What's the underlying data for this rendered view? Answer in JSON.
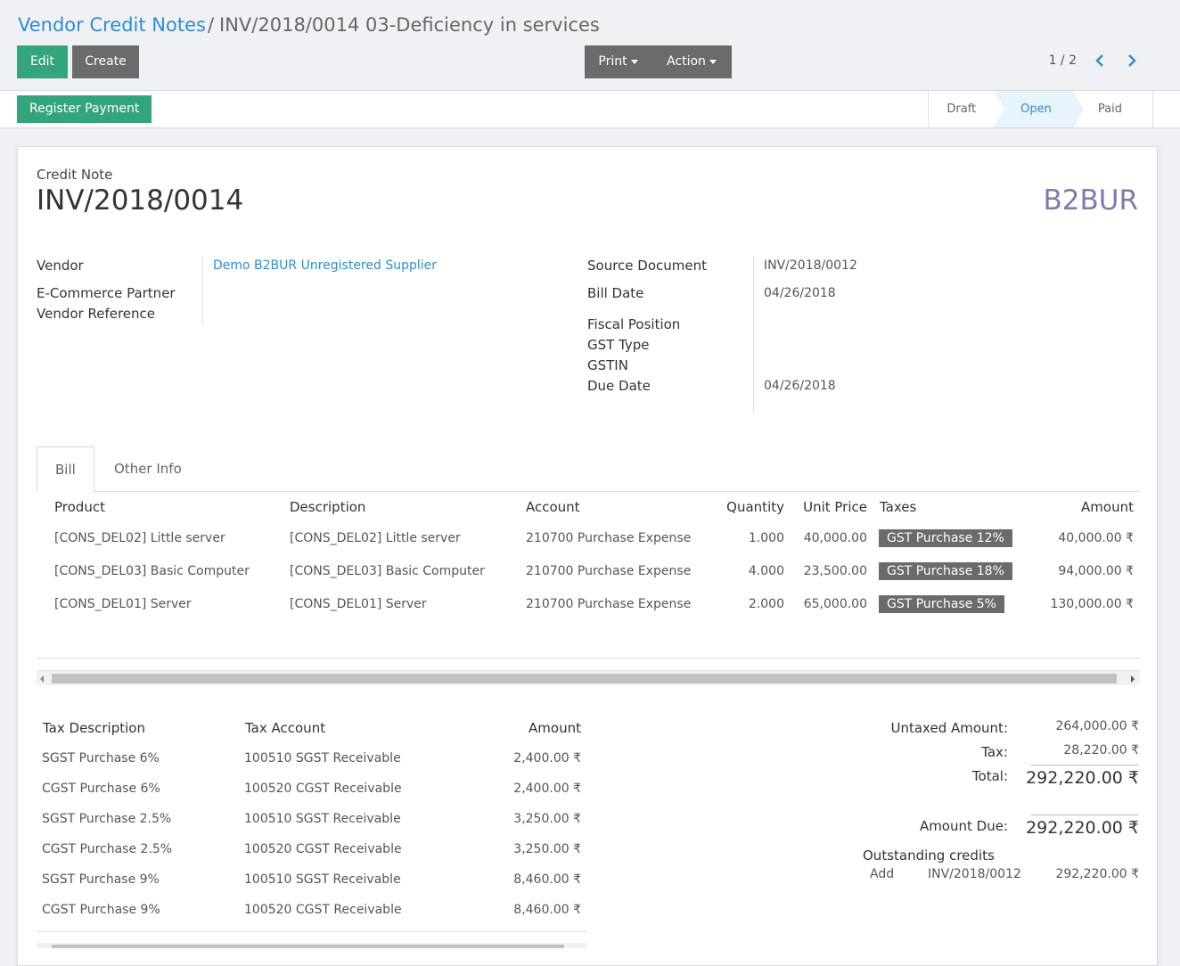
{
  "breadcrumb": {
    "parent": "Vendor Credit Notes",
    "separator": "/",
    "current": "INV/2018/0014 03-Deficiency in services"
  },
  "toolbar": {
    "edit_label": "Edit",
    "create_label": "Create",
    "print_label": "Print",
    "action_label": "Action"
  },
  "pager": {
    "value": "1 / 2"
  },
  "statusbar": {
    "register_payment_label": "Register Payment",
    "stages": [
      "Draft",
      "Open",
      "Paid"
    ],
    "active_stage": "Open"
  },
  "header": {
    "kind": "Credit Note",
    "number": "INV/2018/0014",
    "journal": "B2BUR"
  },
  "left_fields": {
    "vendor_label": "Vendor",
    "vendor_value": "Demo B2BUR Unregistered Supplier",
    "ecommerce_label": "E-Commerce Partner",
    "vendor_ref_label": "Vendor Reference"
  },
  "right_fields": {
    "source_doc_label": "Source Document",
    "source_doc_value": "INV/2018/0012",
    "bill_date_label": "Bill Date",
    "bill_date_value": "04/26/2018",
    "fiscal_label": "Fiscal Position",
    "gst_type_label": "GST Type",
    "gstin_label": "GSTIN",
    "due_date_label": "Due Date",
    "due_date_value": "04/26/2018"
  },
  "tabs": [
    "Bill",
    "Other Info"
  ],
  "lines": {
    "headers": [
      "Product",
      "Description",
      "Account",
      "Quantity",
      "Unit Price",
      "Taxes",
      "Amount"
    ],
    "rows": [
      {
        "product": "[CONS_DEL02] Little server",
        "description": "[CONS_DEL02] Little server",
        "account": "210700 Purchase Expense",
        "quantity": "1.000",
        "unit_price": "40,000.00",
        "tax": "GST Purchase 12%",
        "amount": "40,000.00 ₹"
      },
      {
        "product": "[CONS_DEL03] Basic Computer",
        "description": "[CONS_DEL03] Basic Computer",
        "account": "210700 Purchase Expense",
        "quantity": "4.000",
        "unit_price": "23,500.00",
        "tax": "GST Purchase 18%",
        "amount": "94,000.00 ₹"
      },
      {
        "product": "[CONS_DEL01] Server",
        "description": "[CONS_DEL01] Server",
        "account": "210700 Purchase Expense",
        "quantity": "2.000",
        "unit_price": "65,000.00",
        "tax": "GST Purchase 5%",
        "amount": "130,000.00 ₹"
      }
    ]
  },
  "tax_table": {
    "headers": [
      "Tax Description",
      "Tax Account",
      "Amount"
    ],
    "rows": [
      {
        "desc": "SGST Purchase 6%",
        "account": "100510 SGST Receivable",
        "amount": "2,400.00 ₹"
      },
      {
        "desc": "CGST Purchase 6%",
        "account": "100520 CGST Receivable",
        "amount": "2,400.00 ₹"
      },
      {
        "desc": "SGST Purchase 2.5%",
        "account": "100510 SGST Receivable",
        "amount": "3,250.00 ₹"
      },
      {
        "desc": "CGST Purchase 2.5%",
        "account": "100520 CGST Receivable",
        "amount": "3,250.00 ₹"
      },
      {
        "desc": "SGST Purchase 9%",
        "account": "100510 SGST Receivable",
        "amount": "8,460.00 ₹"
      },
      {
        "desc": "CGST Purchase 9%",
        "account": "100520 CGST Receivable",
        "amount": "8,460.00 ₹"
      }
    ]
  },
  "totals": {
    "untaxed_label": "Untaxed Amount:",
    "untaxed_value": "264,000.00 ₹",
    "tax_label": "Tax:",
    "tax_value": "28,220.00 ₹",
    "total_label": "Total:",
    "total_value": "292,220.00 ₹",
    "due_label": "Amount Due:",
    "due_value": "292,220.00 ₹",
    "outstanding_label": "Outstanding credits",
    "outstanding": {
      "action": "Add",
      "ref": "INV/2018/0012",
      "amount": "292,220.00 ₹"
    }
  },
  "colors": {
    "brand_green": "#34a57b",
    "link_blue": "#2c8ecf",
    "journal_purple": "#7c7bad",
    "button_grey": "#6b6b6b"
  }
}
